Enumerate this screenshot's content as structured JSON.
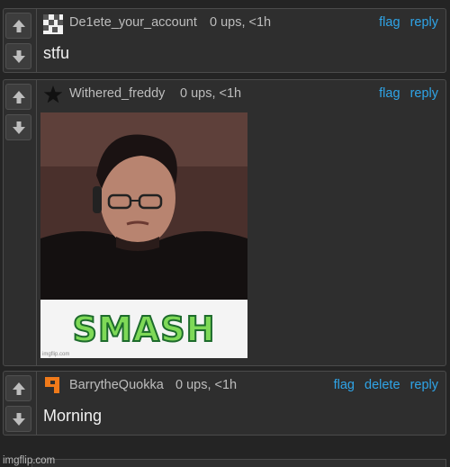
{
  "comments": [
    {
      "username": "De1ete_your_account",
      "meta": "0 ups, <1h",
      "actions": [
        "flag",
        "reply"
      ],
      "text": "stfu",
      "avatar_icon": "checker-avatar-icon"
    },
    {
      "username": "Withered_freddy",
      "meta": "0 ups, <1h",
      "actions": [
        "flag",
        "reply"
      ],
      "image_caption": "SMASH",
      "image_watermark": "imgflip.com",
      "avatar_icon": "star-avatar-icon"
    },
    {
      "username": "BarrytheQuokka",
      "meta": "0 ups, <1h",
      "actions": [
        "flag",
        "delete",
        "reply"
      ],
      "text": "Morning",
      "avatar_icon": "orange-avatar-icon"
    }
  ],
  "footer": {
    "watermark": "imgflip.com"
  },
  "colors": {
    "background": "#242424",
    "link": "#2fa4e7",
    "panel": "#2e2e2e"
  }
}
